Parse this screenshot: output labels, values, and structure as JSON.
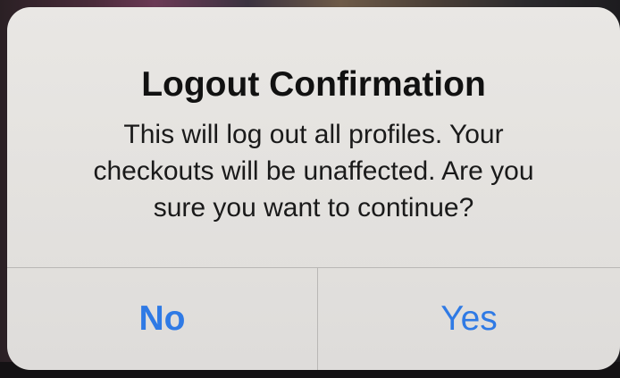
{
  "alert": {
    "title": "Logout Confirmation",
    "message": "This will log out all profiles. Your\ncheckouts will be unaffected. Are you\nsure you want to continue?",
    "buttons": {
      "no_label": "No",
      "yes_label": "Yes"
    }
  },
  "colors": {
    "button_text": "#2f7ae5",
    "alert_background": "#e5e3e0"
  }
}
